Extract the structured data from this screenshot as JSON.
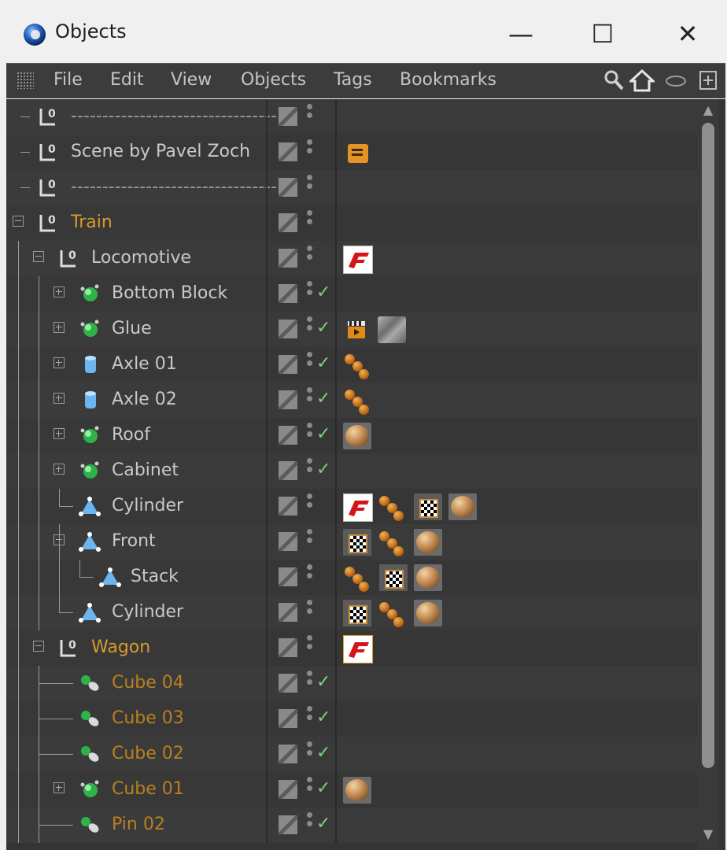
{
  "window": {
    "title": "Objects",
    "controls": {
      "minimize": "—",
      "maximize": "☐",
      "close": "✕"
    }
  },
  "menu": {
    "items": [
      "File",
      "Edit",
      "View",
      "Objects",
      "Tags",
      "Bookmarks"
    ],
    "tools": [
      "search-icon",
      "home-icon",
      "link-icon",
      "new-window-icon"
    ]
  },
  "rows": [
    {
      "label": "---------------------------------",
      "type": "null",
      "tags": []
    },
    {
      "label": "Scene by Pavel Zoch",
      "type": "null",
      "tags": [
        "note"
      ]
    },
    {
      "label": "---------------------------------",
      "type": "null",
      "tags": []
    },
    {
      "label": "Train",
      "type": "null",
      "color": "orange",
      "tags": []
    },
    {
      "label": "Locomotive",
      "type": "null",
      "tags": [
        "texture-f"
      ]
    },
    {
      "label": "Bottom Block",
      "type": "generator",
      "check": true,
      "tags": []
    },
    {
      "label": "Glue",
      "type": "generator",
      "check": true,
      "tags": [
        "clapper",
        "glass"
      ]
    },
    {
      "label": "Axle 01",
      "type": "cylinder",
      "check": true,
      "tags": [
        "balls"
      ]
    },
    {
      "label": "Axle 02",
      "type": "cylinder",
      "check": true,
      "tags": [
        "balls"
      ]
    },
    {
      "label": "Roof",
      "type": "generator",
      "check": true,
      "tags": [
        "sphere"
      ]
    },
    {
      "label": "Cabinet",
      "type": "generator",
      "check": true,
      "tags": []
    },
    {
      "label": "Cylinder",
      "type": "poly",
      "tags": [
        "texture-f",
        "balls",
        "checker",
        "sphere"
      ]
    },
    {
      "label": "Front",
      "type": "poly",
      "tags": [
        "checker",
        "balls",
        "sphere"
      ]
    },
    {
      "label": "Stack",
      "type": "poly",
      "tags": [
        "balls",
        "checker",
        "sphere"
      ]
    },
    {
      "label": "Cylinder",
      "type": "poly",
      "tags": [
        "checker",
        "balls",
        "sphere"
      ]
    },
    {
      "label": "Wagon",
      "type": "null",
      "color": "orange",
      "tags": [
        "texture-f"
      ]
    },
    {
      "label": "Cube 04",
      "type": "instance",
      "color": "dark-orange",
      "check": true,
      "tags": []
    },
    {
      "label": "Cube 03",
      "type": "instance",
      "color": "dark-orange",
      "check": true,
      "tags": []
    },
    {
      "label": "Cube 02",
      "type": "instance",
      "color": "dark-orange",
      "check": true,
      "tags": []
    },
    {
      "label": "Cube 01",
      "type": "generator",
      "color": "dark-orange",
      "check": true,
      "tags": [
        "sphere"
      ]
    },
    {
      "label": "Pin 02",
      "type": "instance",
      "color": "dark-orange",
      "check": true,
      "tags": []
    }
  ]
}
